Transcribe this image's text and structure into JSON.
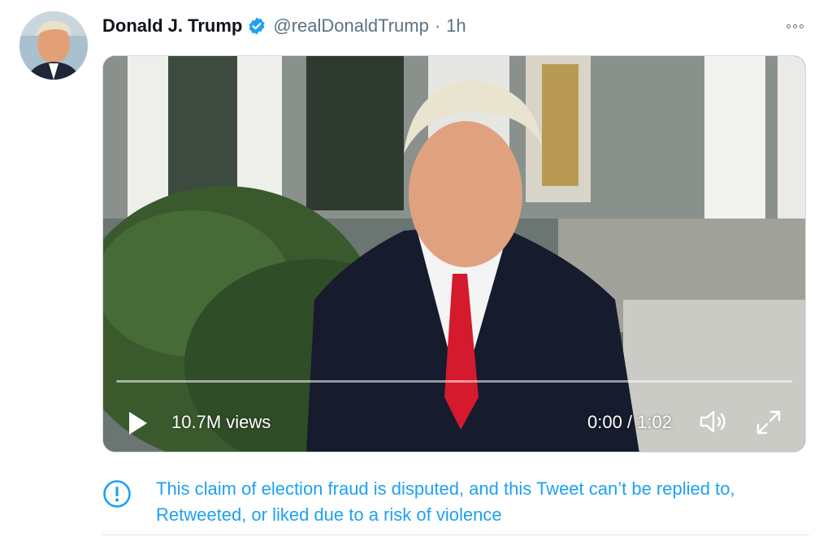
{
  "tweet": {
    "display_name": "Donald J. Trump",
    "verified_icon": "verified-badge-icon",
    "handle": "@realDonaldTrump",
    "separator": "·",
    "time": "1h",
    "more_icon": "more-options-icon"
  },
  "video": {
    "views": "10.7M views",
    "time": "0:00 / 1:02",
    "progress_fraction": 0,
    "controls": [
      "play-icon",
      "volume-icon",
      "fullscreen-icon"
    ]
  },
  "notice": {
    "icon": "exclamation-circle-icon",
    "text": "This claim of election fraud is disputed, and this Tweet can’t be replied to, Retweeted, or liked due to a risk of violence"
  },
  "colors": {
    "link_blue": "#1da1f2",
    "muted_gray": "#5b7083",
    "text_dark": "#0f1419"
  }
}
